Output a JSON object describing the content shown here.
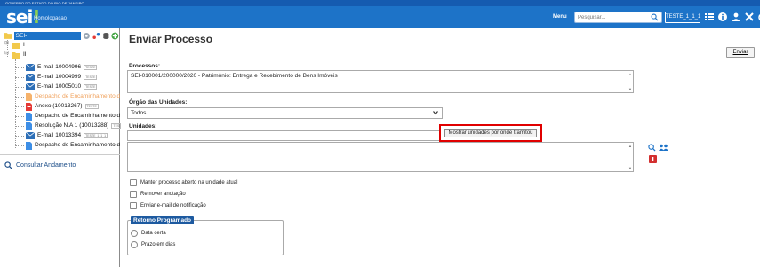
{
  "header": {
    "gov_label": "GOVERNO DO ESTADO DO RIO DE JANEIRO",
    "logo_text": "sei",
    "logo_dot": "!",
    "environment": "Homologacao",
    "menu_label": "Menu",
    "search_placeholder": "Pesquisar...",
    "unit_label": "TESTE_1_1_1",
    "icons": [
      "grid-icon",
      "info-icon",
      "user-icon",
      "tools-icon",
      "power-icon"
    ]
  },
  "tree": {
    "process_number": "SEI-010001/200000/2020",
    "folder1": "I",
    "folder2": "II",
    "items": [
      {
        "label": "E-mail 10004996",
        "tag": "TESTE",
        "type": "mail"
      },
      {
        "label": "E-mail 10004999",
        "tag": "TESTE",
        "type": "mail"
      },
      {
        "label": "E-mail 10005010",
        "tag": "TESTE",
        "type": "mail"
      },
      {
        "label": "Despacho de Encaminhamento d",
        "tag": "",
        "type": "doc-orange"
      },
      {
        "label": "Anexo (10013267)",
        "tag": "TESTE",
        "type": "pdf"
      },
      {
        "label": "Despacho de Encaminhamento d",
        "tag": "",
        "type": "doc"
      },
      {
        "label": "Resolução N.A 1 (10013288)",
        "tag": "TES",
        "type": "doc"
      },
      {
        "label": "E-mail 10013394",
        "tag": "TESTE_1_1_1",
        "type": "mail"
      },
      {
        "label": "Despacho de Encaminhamento d",
        "tag": "",
        "type": "doc"
      }
    ],
    "consultar": "Consultar Andamento"
  },
  "main": {
    "title": "Enviar Processo",
    "send_button": "Enviar",
    "processos_label": "Processos:",
    "processos_value": "SEI-010001/200000/2020 - Patrimônio: Entrega e Recebimento de Bens Imóveis",
    "orgao_label": "Órgão das Unidades:",
    "orgao_value": "Todos",
    "unidades_label": "Unidades:",
    "mostrar_button": "Mostrar unidades por onde tramitou",
    "options": [
      "Manter processo aberto na unidade atual",
      "Remover anotação",
      "Enviar e-mail de notificação"
    ],
    "retorno_legend": "Retorno Programado",
    "retorno_options": [
      "Data certa",
      "Prazo em dias"
    ]
  },
  "colors": {
    "header_blue": "#1d73c8",
    "gov_bar": "#155bb0",
    "highlight_red": "#e00000",
    "legend_blue": "#1d5aa0",
    "orange_text": "#f0a05a"
  }
}
